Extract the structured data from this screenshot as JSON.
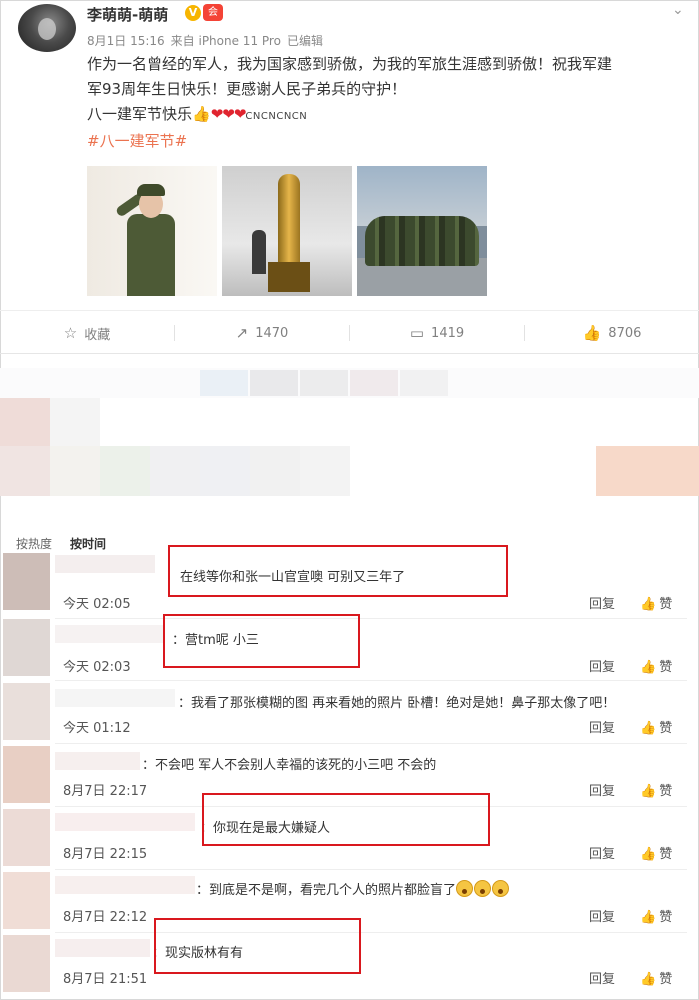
{
  "post": {
    "username": "李萌萌-萌萌",
    "verified_badge": "V",
    "member_icon": "会",
    "date": "8月1日 15:16",
    "source": "来自 iPhone 11 Pro",
    "edited": "已编辑",
    "line1": "作为一名曾经的军人，我为国家感到骄傲，为我的军旅生涯感到骄傲！祝我军建",
    "line2": "军93周年生日快乐！更感谢人民子弟兵的守护！",
    "line3_text": "八一建军节快乐",
    "line3_thumb": "👍",
    "line3_hearts": "❤❤❤",
    "line3_suffix": "CNCNCNCN",
    "hashtag": "#八一建军节#"
  },
  "actions": [
    {
      "icon": "star-icon",
      "glyph": "☆",
      "label": "收藏"
    },
    {
      "icon": "share-icon",
      "glyph": "↗",
      "label": "1470"
    },
    {
      "icon": "comment-icon",
      "glyph": "▭",
      "label": "1419"
    },
    {
      "icon": "like-icon",
      "glyph": "👍",
      "label": "8706"
    }
  ],
  "tabs": {
    "hot": "按热度",
    "time": "按时间"
  },
  "comments": [
    {
      "text": "在线等你和张一山官宣噢  可别又三年了",
      "time": "今天 02:05",
      "reply": "回复",
      "like": "赞"
    },
    {
      "text": "：营tm呢  小三",
      "time": "今天 02:03",
      "reply": "回复",
      "like": "赞"
    },
    {
      "text": "：我看了那张模糊的图 再来看她的照片 卧槽！绝对是她！鼻子那太像了吧！",
      "time": "今天 01:12",
      "reply": "回复",
      "like": "赞"
    },
    {
      "text": "：不会吧 军人不会别人幸福的该死的小三吧 不会的",
      "time": "8月7日 22:17",
      "reply": "回复",
      "like": "赞"
    },
    {
      "text": "：你现在是最大嫌疑人",
      "time": "8月7日 22:15",
      "reply": "回复",
      "like": "赞"
    },
    {
      "text": "：到底是不是啊，看完几个人的照片都脸盲了",
      "time": "8月7日 22:12",
      "reply": "回复",
      "like": "赞"
    },
    {
      "text": "：现实版林有有",
      "time": "8月7日 21:51",
      "reply": "回复",
      "like": "赞"
    }
  ],
  "colors": {
    "accent": "#eb7350",
    "highlight_box": "#d9181e",
    "verified": "#f7b500"
  }
}
